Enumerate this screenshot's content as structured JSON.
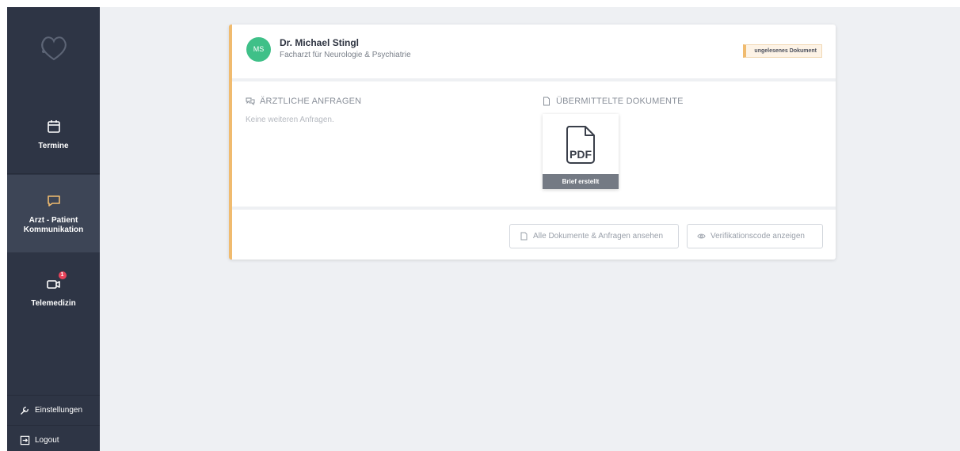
{
  "sidebar": {
    "logo_icon": "heart-stethoscope-icon",
    "items": [
      {
        "label": "Termine",
        "icon": "calendar-icon"
      },
      {
        "label": "Arzt - Patient Kommunikation",
        "icon": "chat-icon",
        "active": true
      },
      {
        "label": "Telemedizin",
        "icon": "video-icon",
        "badge": "1"
      }
    ],
    "settings_label": "Einstellungen",
    "logout_label": "Logout"
  },
  "card": {
    "avatar_initials": "MS",
    "doctor_name": "Dr. Michael Stingl",
    "doctor_specialty": "Facharzt für Neurologie & Psychiatrie",
    "unread_badge": "ungelesenes Dokument",
    "requests_title": "ÄRZTLICHE ANFRAGEN",
    "requests_empty": "Keine weiteren Anfragen.",
    "documents_title": "ÜBERMITTELTE DOKUMENTE",
    "document": {
      "type_label": "PDF",
      "caption": "Brief erstellt"
    },
    "btn_all_documents": "Alle Dokumente & Anfragen ansehen",
    "btn_verification": "Verifikationscode anzeigen"
  },
  "colors": {
    "sidebar_bg": "#2e3545",
    "sidebar_active_bg": "#3d4556",
    "accent_orange": "#f0bb6f",
    "avatar_green": "#3fc088",
    "badge_red": "#e8435a",
    "main_bg": "#eef0f3"
  }
}
